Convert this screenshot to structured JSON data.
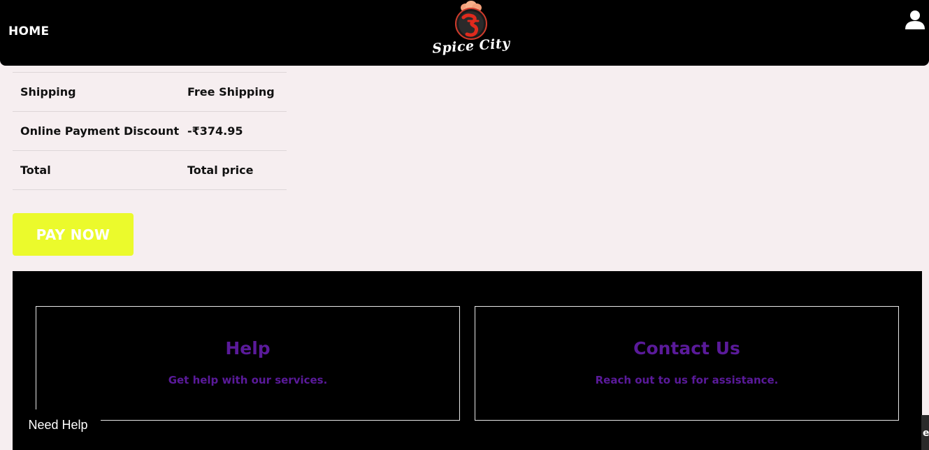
{
  "header": {
    "home_label": "HOME",
    "logo_text": "Spice City",
    "logo_icon": "chef-hat-logo-icon",
    "user_icon": "user-icon"
  },
  "summary": {
    "rows": [
      {
        "label": "Shipping",
        "value": "Free Shipping"
      },
      {
        "label": "Online Payment Discount",
        "value": "-₹374.95"
      },
      {
        "label": "Total",
        "value": "Total price"
      }
    ]
  },
  "pay_button": {
    "label": "PAY NOW",
    "color": "#ebfa2c"
  },
  "footer": {
    "help": {
      "title": "Help",
      "text": "Get help with our services."
    },
    "contact": {
      "title": "Contact Us",
      "text": "Reach out to us for assistance."
    },
    "accent_color": "#5a1a9a"
  },
  "need_help": {
    "label": "Need Help"
  },
  "corner_tab": {
    "label": "e"
  }
}
